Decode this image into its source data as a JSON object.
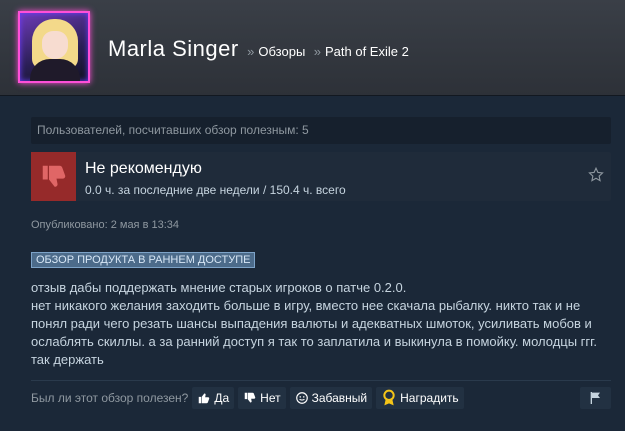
{
  "header": {
    "user_name": "Marla Singer",
    "breadcrumb_sep_1": "»",
    "breadcrumb_1": "Обзоры",
    "breadcrumb_sep_2": "»",
    "breadcrumb_2": "Path of Exile 2"
  },
  "review": {
    "helpful_count_text": "Пользователей, посчитавших обзор полезным: 5",
    "recommendation": "Не рекомендую",
    "hours": "0.0 ч. за последние две недели / 150.4 ч. всего",
    "posted": "Опубликовано: 2 мая в 13:34",
    "early_access_badge": "ОБЗОР ПРОДУКТА В РАННЕМ ДОСТУПЕ",
    "text_lines": [
      "отзыв дабы поддержать мнение старых игроков о патче 0.2.0.",
      "нет никакого желания заходить больше в игру, вместо нее скачала рыбалку. никто так и не",
      "понял ради чего резать шансы выпадения валюты и адекватных шмоток, усиливать мобов и",
      "ослаблять скиллы. а за ранний доступ я так то заплатила и выкинула в помойку. молодцы ггг.",
      "так держать"
    ]
  },
  "vote": {
    "question": "Был ли этот обзор полезен?",
    "yes_label": "Да",
    "no_label": "Нет",
    "funny_label": "Забавный",
    "award_label": "Наградить"
  },
  "colors": {
    "background": "#1b2838",
    "not_recommended": "#962a2a",
    "badge": "#4c6b8a"
  },
  "icons": [
    "thumbs-down-icon",
    "star-icon",
    "thumbs-up-icon",
    "smiley-icon",
    "award-icon",
    "flag-icon"
  ]
}
